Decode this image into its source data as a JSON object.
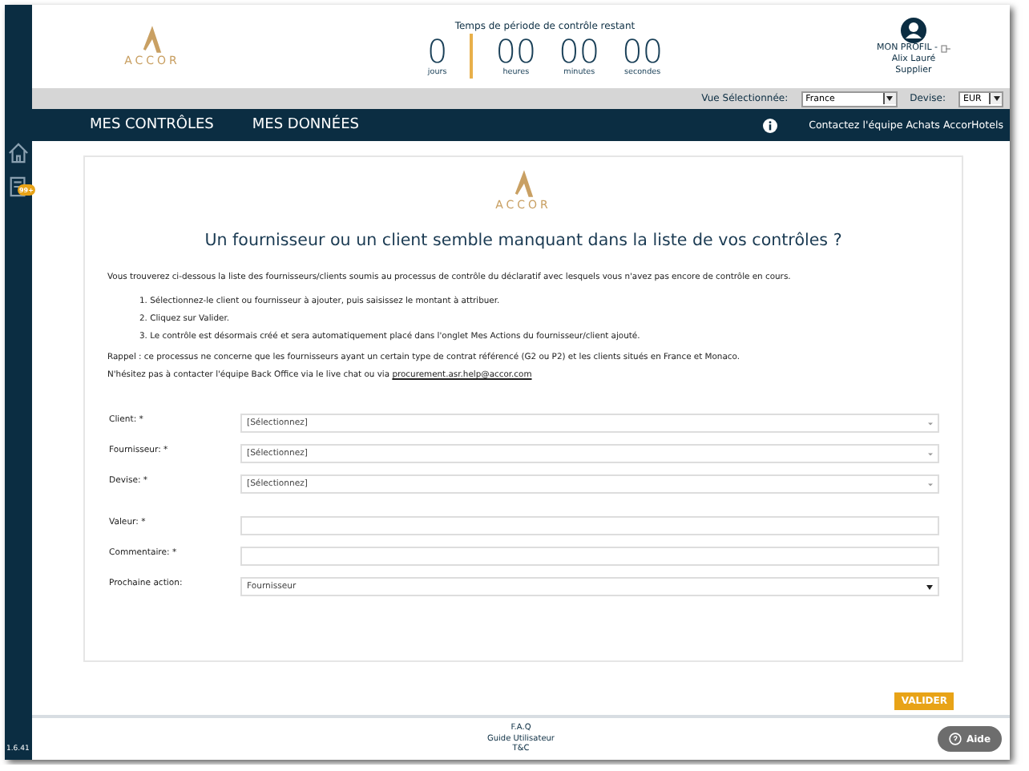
{
  "sidebar": {
    "badge": "99+",
    "version": "1.6.41"
  },
  "header": {
    "logo": "ACCOR",
    "countdown_title": "Temps de période de contrôle restant",
    "countdown": [
      {
        "value": "0",
        "unit": "jours"
      },
      {
        "value": "00",
        "unit": "heures"
      },
      {
        "value": "00",
        "unit": "minutes"
      },
      {
        "value": "00",
        "unit": "secondes"
      }
    ],
    "profile": {
      "label": "MON PROFIL -",
      "name": "Alix Lauré",
      "role": "Supplier"
    }
  },
  "filter_bar": {
    "view_label": "Vue Sélectionnée:",
    "view_value": "France",
    "currency_label": "Devise:",
    "currency_value": "EUR"
  },
  "nav": {
    "items": [
      "MES CONTRÔLES",
      "MES DONNÉES"
    ],
    "contact": "Contactez l'équipe Achats AccorHotels"
  },
  "card": {
    "logo": "ACCOR",
    "title": "Un fournisseur ou un client semble manquant dans la liste de vos contrôles ?",
    "intro": "Vous trouverez ci-dessous la liste des fournisseurs/clients soumis au processus de contrôle du déclaratif avec lesquels vous n'avez pas encore de contrôle en cours.",
    "steps": [
      "1. Sélectionnez-le client ou fournisseur à ajouter, puis saisissez le montant à attribuer.",
      "2. Cliquez sur Valider.",
      "3. Le contrôle est désormais créé et sera automatiquement placé dans l'onglet Mes Actions du fournisseur/client ajouté."
    ],
    "reminder": "Rappel : ce processus ne concerne que les fournisseurs ayant un certain type de contrat référencé (G2 ou P2) et les clients situés en France et Monaco.",
    "contact_text": "N'hésitez pas à contacter l'équipe Back Office via le live chat ou via",
    "contact_link": "procurement.asr.help@accor.com",
    "fields": [
      {
        "label": "Client: *",
        "kind": "select",
        "value": "[Sélectionnez]"
      },
      {
        "label": "Fournisseur: *",
        "kind": "select",
        "value": "[Sélectionnez]"
      },
      {
        "label": "Devise: *",
        "kind": "select",
        "value": "[Sélectionnez]"
      },
      {
        "label": "Valeur: *",
        "kind": "text"
      },
      {
        "label": "Commentaire: *",
        "kind": "text"
      },
      {
        "label": "Prochaine action:",
        "kind": "dropdown",
        "value": "Fournisseur"
      }
    ]
  },
  "submit": "VALIDER",
  "footer": {
    "links": [
      "F.A.Q",
      "Guide Utilisateur",
      "T&C"
    ],
    "help": "Aide"
  }
}
